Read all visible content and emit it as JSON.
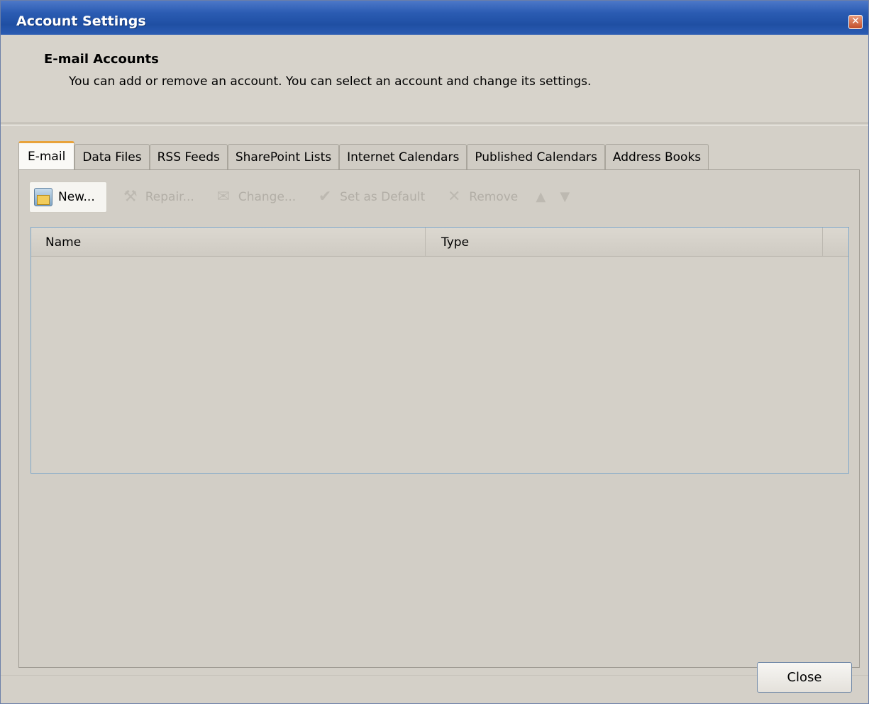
{
  "window": {
    "title": "Account Settings",
    "close_glyph": "✕"
  },
  "header": {
    "title": "E-mail Accounts",
    "description": "You can add or remove an account. You can select an account and change its settings."
  },
  "tabs": [
    {
      "label": "E-mail",
      "active": true
    },
    {
      "label": "Data Files",
      "active": false
    },
    {
      "label": "RSS Feeds",
      "active": false
    },
    {
      "label": "SharePoint Lists",
      "active": false
    },
    {
      "label": "Internet Calendars",
      "active": false
    },
    {
      "label": "Published Calendars",
      "active": false
    },
    {
      "label": "Address Books",
      "active": false
    }
  ],
  "toolbar": {
    "new_label": "New...",
    "repair_label": "Repair...",
    "change_label": "Change...",
    "set_default_label": "Set as Default",
    "remove_label": "Remove",
    "new_icon": "mailbox-icon",
    "repair_icon": "tools-icon",
    "change_icon": "envelope-icon",
    "set_default_icon": "checkmark-icon",
    "remove_icon": "x-icon",
    "up_icon": "arrow-up-icon",
    "down_icon": "arrow-down-icon"
  },
  "accounts_list": {
    "columns": [
      "Name",
      "Type"
    ],
    "rows": []
  },
  "footer": {
    "close_label": "Close"
  },
  "colors": {
    "titlebar": "#2b5cb3",
    "active_tab_accent": "#e8a23a",
    "list_border": "#7fa7c9"
  }
}
